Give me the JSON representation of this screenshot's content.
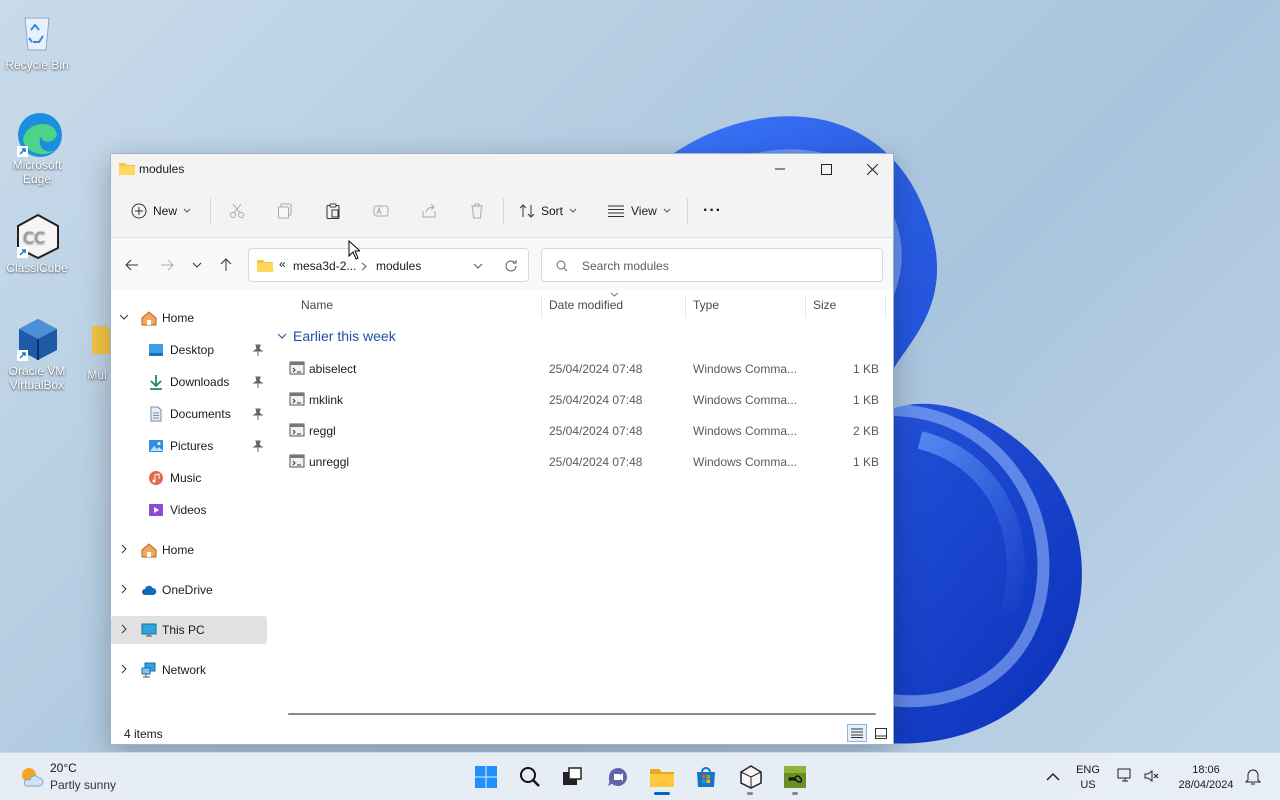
{
  "desktop": {
    "icons": [
      {
        "label": "Recycle Bin"
      },
      {
        "label": "Microsoft Edge"
      },
      {
        "label": "ClassiCube"
      },
      {
        "label": "Oracle VM VirtualBox"
      },
      {
        "label": "Mul"
      }
    ]
  },
  "window": {
    "title": "modules",
    "toolbar": {
      "new_label": "New",
      "sort_label": "Sort",
      "view_label": "View",
      "more_label": "···"
    },
    "address": {
      "overflow": "«",
      "crumbs": [
        "mesa3d-2...",
        "modules"
      ]
    },
    "search": {
      "placeholder": "Search modules"
    },
    "sidebar": {
      "items": [
        {
          "label": "Home"
        },
        {
          "label": "Desktop"
        },
        {
          "label": "Downloads"
        },
        {
          "label": "Documents"
        },
        {
          "label": "Pictures"
        },
        {
          "label": "Music"
        },
        {
          "label": "Videos"
        },
        {
          "label": "Home"
        },
        {
          "label": "OneDrive"
        },
        {
          "label": "This PC"
        },
        {
          "label": "Network"
        }
      ]
    },
    "columns": [
      "Name",
      "Date modified",
      "Type",
      "Size"
    ],
    "group": "Earlier this week",
    "files": [
      {
        "name": "abiselect",
        "date": "25/04/2024 07:48",
        "type": "Windows Comma...",
        "size": "1 KB"
      },
      {
        "name": "mklink",
        "date": "25/04/2024 07:48",
        "type": "Windows Comma...",
        "size": "1 KB"
      },
      {
        "name": "reggl",
        "date": "25/04/2024 07:48",
        "type": "Windows Comma...",
        "size": "2 KB"
      },
      {
        "name": "unreggl",
        "date": "25/04/2024 07:48",
        "type": "Windows Comma...",
        "size": "1 KB"
      }
    ],
    "status": {
      "count": "4 items"
    }
  },
  "taskbar": {
    "weather": {
      "temp": "20°C",
      "desc": "Partly sunny"
    },
    "lang": {
      "line1": "ENG",
      "line2": "US"
    },
    "clock": {
      "time": "18:06",
      "date": "28/04/2024"
    }
  },
  "colors": {
    "accent": "#0067c0",
    "folder": "#f4c542",
    "wallpaper_blue": "#1a4fd6"
  }
}
